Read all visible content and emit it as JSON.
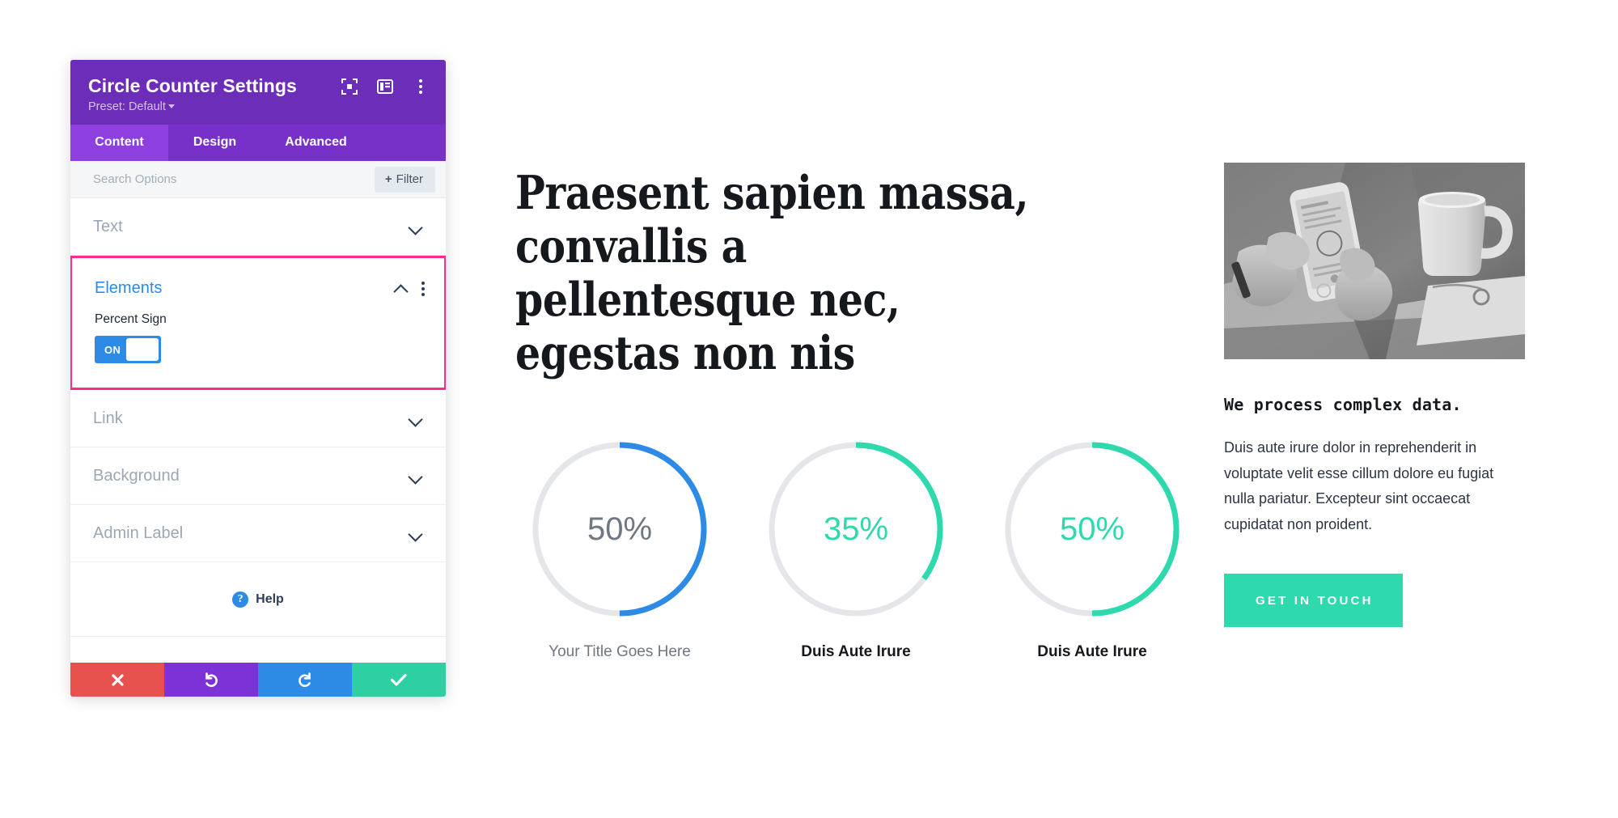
{
  "panel": {
    "title": "Circle Counter Settings",
    "preset": "Preset: Default",
    "header_icons": [
      {
        "name": "focus-expand-icon"
      },
      {
        "name": "panel-layout-icon"
      },
      {
        "name": "more-options-icon"
      }
    ],
    "tabs": [
      {
        "label": "Content",
        "active": true
      },
      {
        "label": "Design",
        "active": false
      },
      {
        "label": "Advanced",
        "active": false
      }
    ],
    "search": {
      "placeholder": "Search Options",
      "filter_label": "Filter",
      "filter_plus": "+"
    },
    "sections": [
      {
        "label": "Text",
        "state": "collapsed"
      },
      {
        "label": "Link",
        "state": "collapsed"
      },
      {
        "label": "Background",
        "state": "collapsed"
      },
      {
        "label": "Admin Label",
        "state": "collapsed"
      }
    ],
    "elements_section": {
      "label": "Elements",
      "state": "expanded",
      "highlighted": true,
      "highlight_color": "#ff2d87",
      "accent_color": "#2d8ae5",
      "field": {
        "label": "Percent Sign",
        "toggle_state": "ON"
      }
    },
    "help": {
      "label": "Help",
      "icon": "?"
    },
    "actions": [
      {
        "name": "cancel",
        "glyph": "x",
        "color": "#e8524e"
      },
      {
        "name": "undo",
        "glyph": "undo",
        "color": "#7c32d6"
      },
      {
        "name": "redo",
        "glyph": "redo",
        "color": "#2d8ae5"
      },
      {
        "name": "save",
        "glyph": "check",
        "color": "#2ecfa3"
      }
    ]
  },
  "main": {
    "heading": "Praesent sapien massa, convallis a pellentesque nec, egestas non nis"
  },
  "chart_data": {
    "type": "pie",
    "title": "Circle Counters",
    "counters": [
      {
        "value": 50,
        "display": "50%",
        "title": "Your Title Goes Here",
        "bar_color": "#2d8ae5",
        "text_color": "#6f7781",
        "track_color": "#e4e6e9",
        "title_weight": "normal"
      },
      {
        "value": 35,
        "display": "35%",
        "title": "Duis Aute Irure",
        "bar_color": "#2ed9ae",
        "text_color": "#2ed9ae",
        "track_color": "#e4e6e9",
        "title_weight": "bold"
      },
      {
        "value": 50,
        "display": "50%",
        "title": "Duis Aute Irure",
        "bar_color": "#2ed9ae",
        "text_color": "#2ed9ae",
        "track_color": "#e4e6e9",
        "title_weight": "bold"
      }
    ]
  },
  "right_column": {
    "image_alt": "hands holding smartphone beside coffee mug",
    "heading": "We process complex data.",
    "body": "Duis aute irure dolor in reprehenderit in voluptate velit esse cillum dolore eu fugiat nulla pariatur. Excepteur sint occaecat cupidatat non proident.",
    "cta_label": "GET IN TOUCH",
    "cta_color": "#2ed9ae"
  }
}
